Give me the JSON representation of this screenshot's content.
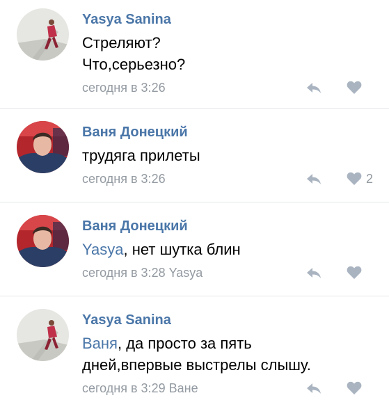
{
  "comments": [
    {
      "author": "Yasya Sanina",
      "avatar": "girl-avatar",
      "lines": [
        "Стреляют?",
        "Что,серьезно?"
      ],
      "time": "сегодня в 3:26",
      "reply_to": "",
      "likes": ""
    },
    {
      "author": "Ваня Донецкий",
      "avatar": "boy-avatar",
      "lines": [
        "трудяга прилеты"
      ],
      "time": "сегодня в 3:26",
      "reply_to": "",
      "likes": "2"
    },
    {
      "author": "Ваня Донецкий",
      "avatar": "boy-avatar",
      "mention": "Yasya",
      "text_rest": ", нет шутка блин",
      "time": "сегодня в 3:28",
      "reply_to": "Yasya",
      "likes": ""
    },
    {
      "author": "Yasya Sanina",
      "avatar": "girl-avatar",
      "mention": "Ваня",
      "text_rest": ", да просто за пять",
      "line2": "дней,впервые выстрелы слышу.",
      "time": "сегодня в 3:29",
      "reply_to": "Ване",
      "likes": ""
    }
  ],
  "colors": {
    "author": "#4a76a8",
    "meta": "#939aa1",
    "icon": "#aab4c1",
    "divider": "#e3e6ea"
  },
  "icons": [
    "reply-arrow-icon",
    "heart-icon"
  ]
}
